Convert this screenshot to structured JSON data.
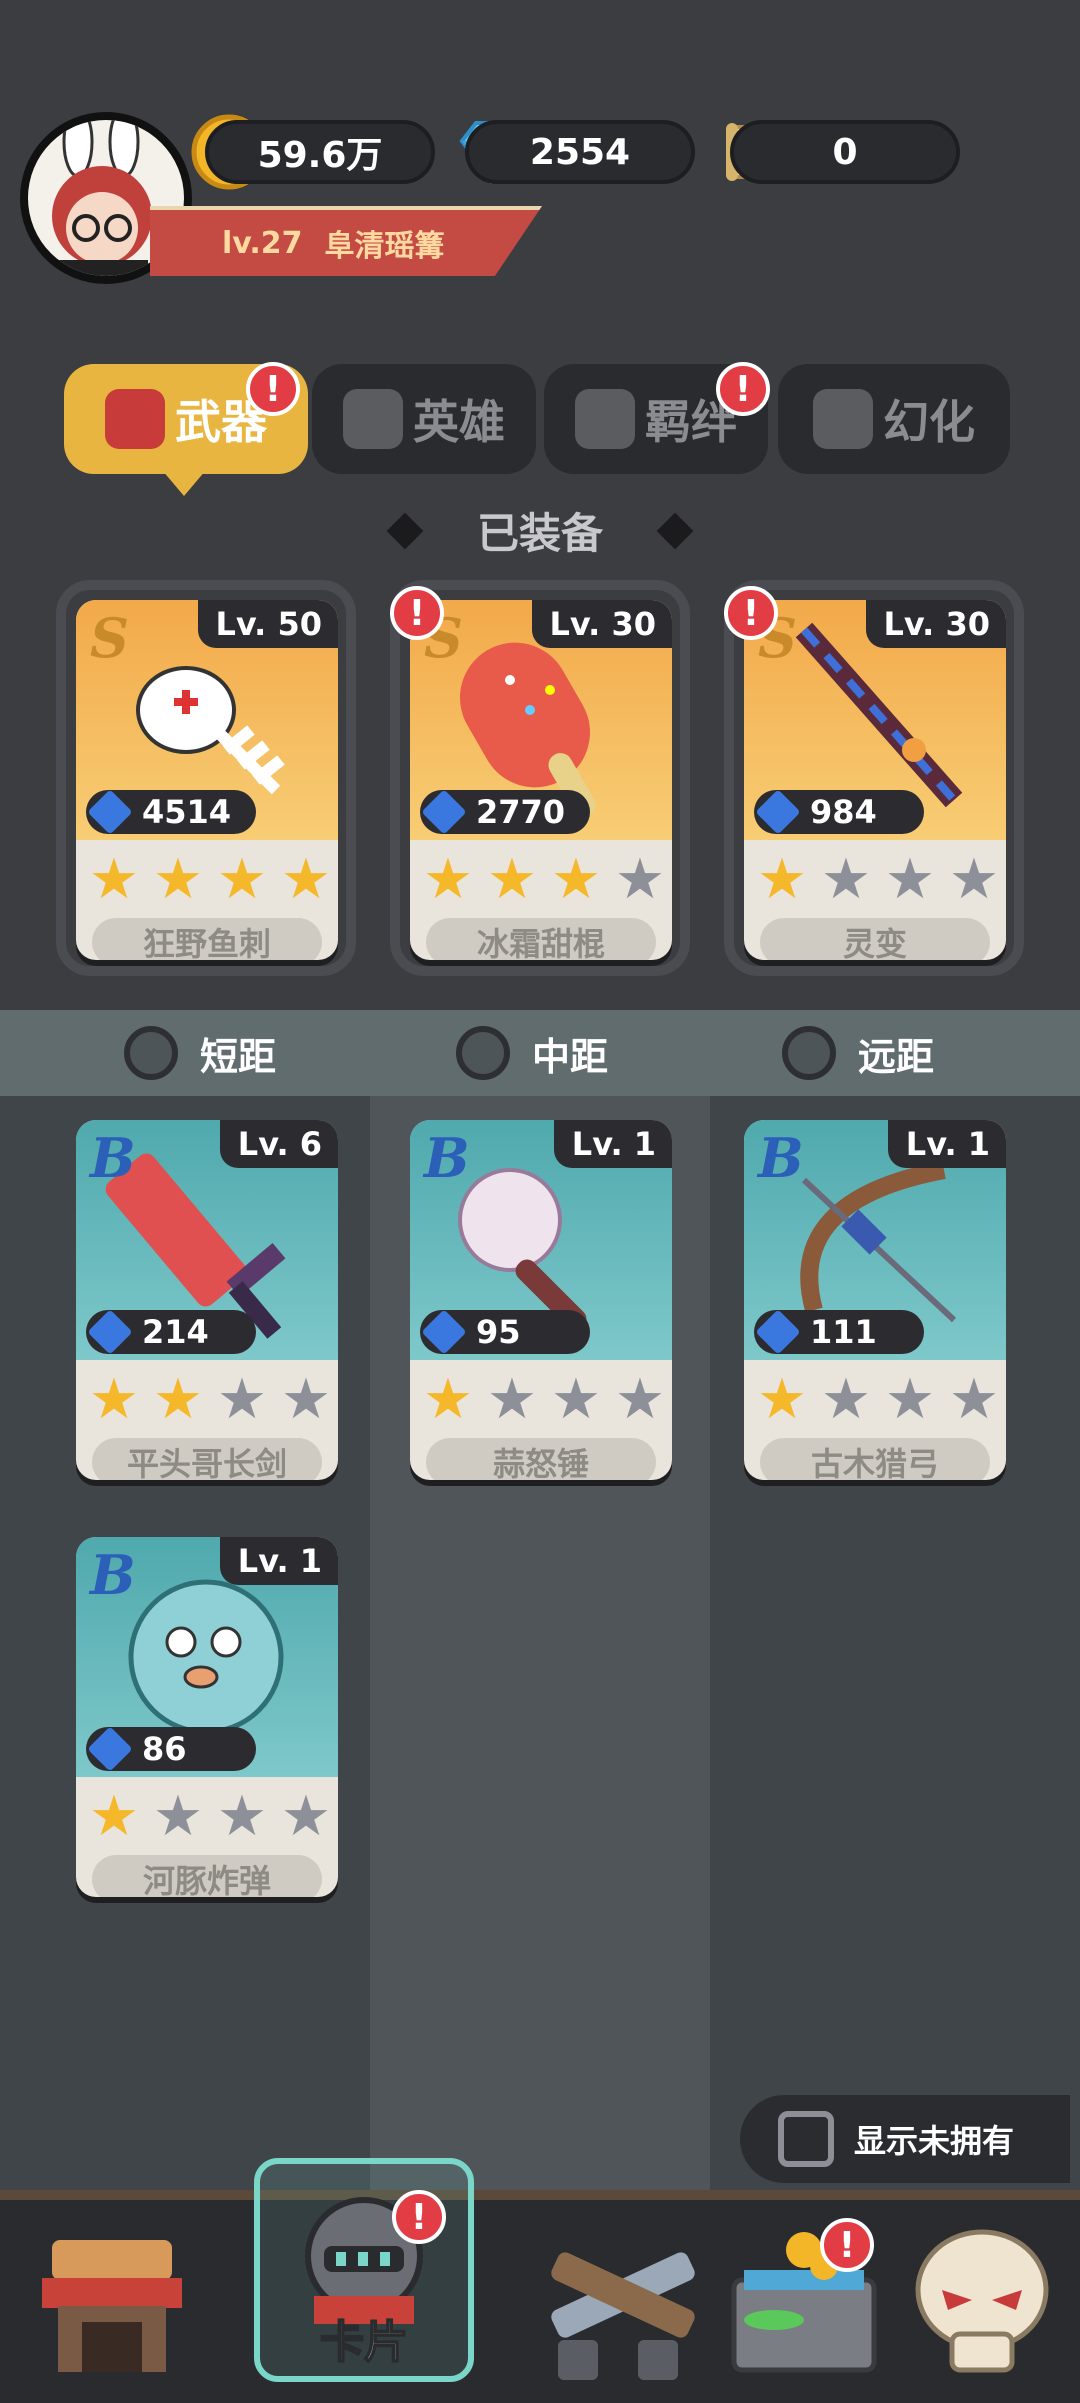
{
  "player": {
    "level": "lv.27",
    "name": "阜清瑶篝",
    "coins": "59.6万",
    "gems": "2554",
    "scrolls": "0"
  },
  "tabs": [
    {
      "label": "武器",
      "badge": "!",
      "active": true
    },
    {
      "label": "英雄",
      "badge": "",
      "active": false
    },
    {
      "label": "羁绊",
      "badge": "!",
      "active": false
    },
    {
      "label": "幻化",
      "badge": "",
      "active": false
    }
  ],
  "equipped": {
    "title": "已装备",
    "cards": [
      {
        "rank": "S",
        "level": "Lv. 50",
        "power": "4514",
        "stars": 4,
        "name": "狂野鱼刺",
        "badge": ""
      },
      {
        "rank": "S",
        "level": "Lv. 30",
        "power": "2770",
        "stars": 3,
        "name": "冰霜甜棍",
        "badge": "!"
      },
      {
        "rank": "S",
        "level": "Lv. 30",
        "power": "984",
        "stars": 1,
        "name": "灵变",
        "badge": "!"
      }
    ]
  },
  "ranges": [
    {
      "label": "短距"
    },
    {
      "label": "中距"
    },
    {
      "label": "远距"
    }
  ],
  "inventory": [
    {
      "rank": "B",
      "level": "Lv. 6",
      "power": "214",
      "stars": 2,
      "name": "平头哥长剑"
    },
    {
      "rank": "B",
      "level": "Lv. 1",
      "power": "95",
      "stars": 1,
      "name": "蒜怒锤"
    },
    {
      "rank": "B",
      "level": "Lv. 1",
      "power": "111",
      "stars": 1,
      "name": "古木猎弓"
    },
    {
      "rank": "B",
      "level": "Lv. 1",
      "power": "86",
      "stars": 1,
      "name": "河豚炸弹"
    }
  ],
  "show_unowned_label": "显示未拥有",
  "nav": [
    {
      "label": "",
      "icon": "shop-icon",
      "badge": ""
    },
    {
      "label": "卡片",
      "icon": "knight-helmet-icon",
      "badge": "!"
    },
    {
      "label": "",
      "icon": "crossed-guns-icon",
      "badge": ""
    },
    {
      "label": "",
      "icon": "treasure-chest-icon",
      "badge": "!"
    },
    {
      "label": "",
      "icon": "skull-icon",
      "badge": ""
    }
  ],
  "colors": {
    "accent": "#e8b640",
    "badge": "#e23c45",
    "star": "#f5b82a"
  }
}
